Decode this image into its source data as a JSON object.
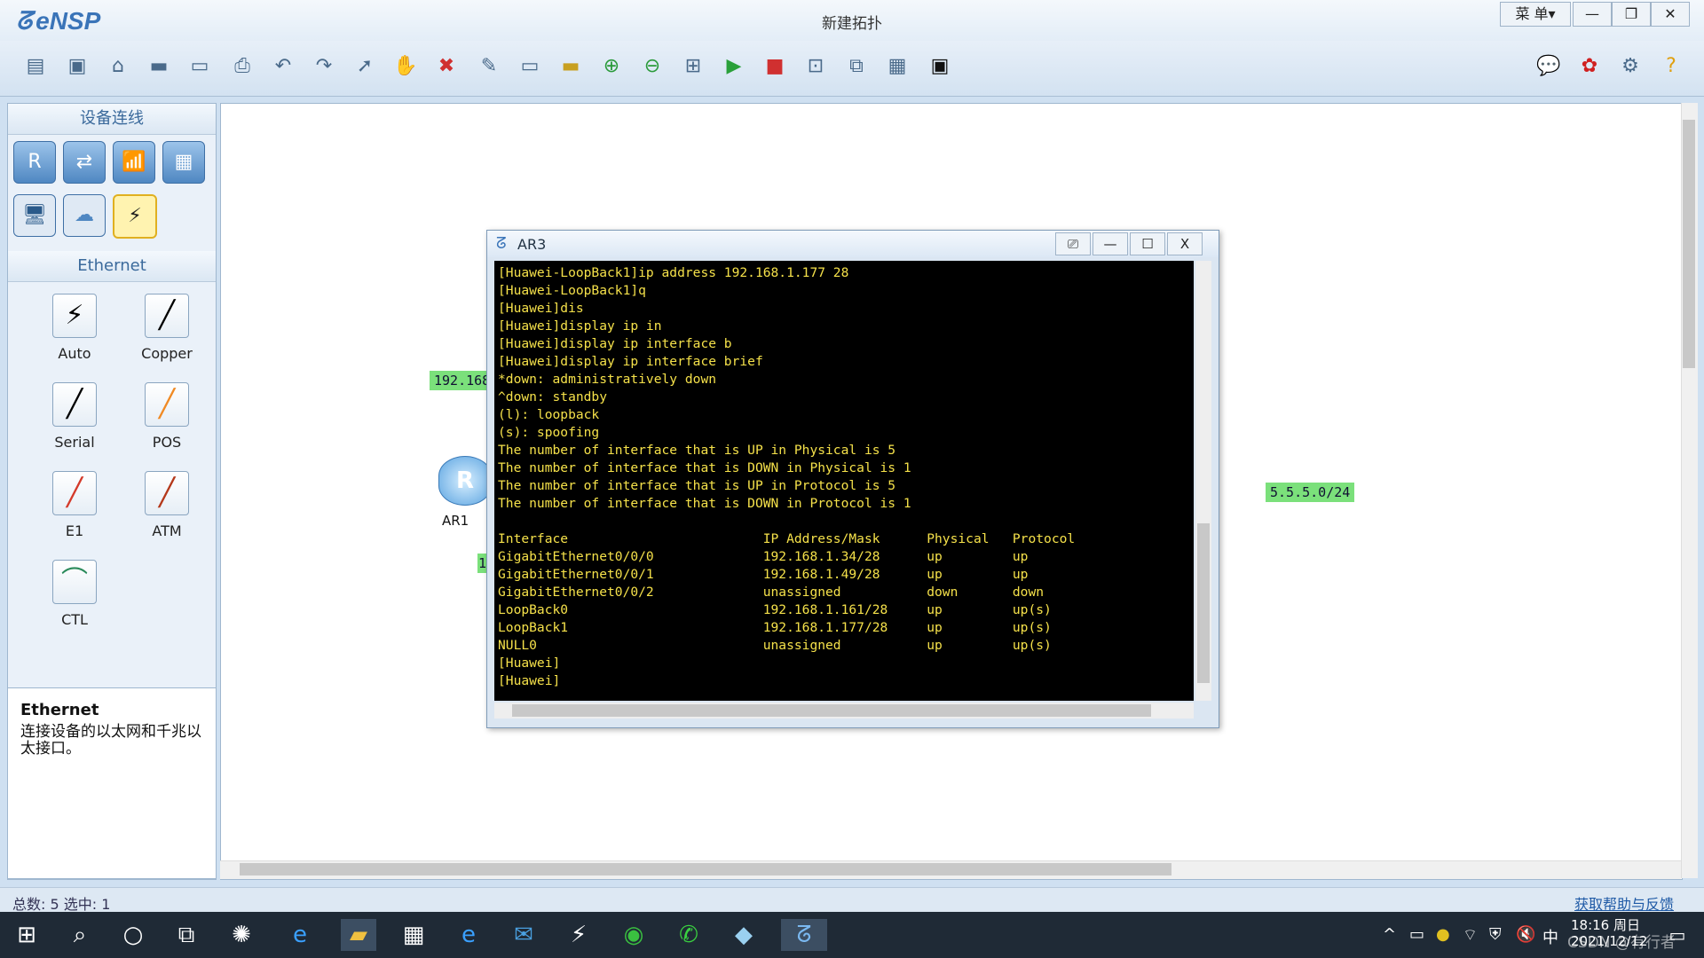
{
  "app": {
    "logo": "eNSP",
    "title": "新建拓扑",
    "menu_label": "菜 单▾",
    "window_buttons": [
      "—",
      "❐",
      "✕"
    ]
  },
  "toolbar": {
    "icons": [
      "new-topology-icon",
      "new-icon",
      "open-icon",
      "save-icon",
      "save-as-icon",
      "print-icon",
      "undo-icon",
      "redo-icon",
      "select-icon",
      "pan-icon",
      "delete-icon",
      "delete-link-icon",
      "text-icon",
      "rectangle-icon",
      "zoom-in-icon",
      "zoom-out-icon",
      "fit-icon",
      "start-icon",
      "stop-icon",
      "capture-icon",
      "topology-icon",
      "grid-icon",
      "console-icon"
    ],
    "right_icons": [
      "chat-icon",
      "huawei-icon",
      "settings-icon",
      "help-icon"
    ]
  },
  "leftpanel": {
    "header": "设备连线",
    "devices": [
      {
        "name": "router",
        "glyph": "R"
      },
      {
        "name": "switch",
        "glyph": "⇄"
      },
      {
        "name": "wlan",
        "glyph": "📶"
      },
      {
        "name": "firewall",
        "glyph": "▦"
      },
      {
        "name": "pc",
        "glyph": "🖥"
      },
      {
        "name": "cloud",
        "glyph": "☁"
      },
      {
        "name": "cable",
        "glyph": "⚡"
      }
    ],
    "section": "Ethernet",
    "cables": [
      {
        "label": "Auto",
        "glyph": "⚡",
        "color": "#111"
      },
      {
        "label": "Copper",
        "glyph": "╱",
        "color": "#111"
      },
      {
        "label": "Serial",
        "glyph": "╱",
        "color": "#111"
      },
      {
        "label": "POS",
        "glyph": "╱",
        "color": "#f08a24"
      },
      {
        "label": "E1",
        "glyph": "╱",
        "color": "#d43a2a"
      },
      {
        "label": "ATM",
        "glyph": "╱",
        "color": "#b4381a"
      },
      {
        "label": "CTL",
        "glyph": "⌒",
        "color": "#2a8a5a"
      }
    ],
    "desc_title": "Ethernet",
    "desc_text": "连接设备的以太网和千兆以太接口。"
  },
  "canvas": {
    "labels": [
      "192.168",
      "5.5.5.0/24",
      "1"
    ],
    "router_label": "AR1",
    "router_glyph": "R"
  },
  "terminal": {
    "title": "AR3",
    "buttons": [
      "⎚",
      "—",
      "☐",
      "X"
    ],
    "lines": [
      "[Huawei-LoopBack1]ip address 192.168.1.177 28",
      "[Huawei-LoopBack1]q",
      "[Huawei]dis",
      "[Huawei]display ip in",
      "[Huawei]display ip interface b",
      "[Huawei]display ip interface brief",
      "*down: administratively down",
      "^down: standby",
      "(l): loopback",
      "(s): spoofing",
      "The number of interface that is UP in Physical is 5",
      "The number of interface that is DOWN in Physical is 1",
      "The number of interface that is UP in Protocol is 5",
      "The number of interface that is DOWN in Protocol is 1",
      "",
      "Interface                         IP Address/Mask      Physical   Protocol",
      "GigabitEthernet0/0/0              192.168.1.34/28      up         up",
      "GigabitEthernet0/0/1              192.168.1.49/28      up         up",
      "GigabitEthernet0/0/2              unassigned           down       down",
      "LoopBack0                         192.168.1.161/28     up         up(s)",
      "LoopBack1                         192.168.1.177/28     up         up(s)",
      "NULL0                             unassigned           up         up(s)",
      "[Huawei]",
      "[Huawei]"
    ]
  },
  "statusbar": {
    "left": "总数: 5  选中: 1",
    "right": "获取帮助与反馈"
  },
  "taskbar": {
    "apps": [
      "windows-start-icon",
      "search-icon",
      "cortana-icon",
      "task-view-icon",
      "app-icon",
      "ie-icon",
      "file-explorer-icon",
      "store-icon",
      "edge-icon",
      "mail-icon",
      "app-bolt-icon",
      "browser-icon",
      "wechat-icon",
      "app-box-icon",
      "ensp-icon"
    ],
    "tray": [
      "^",
      "▭",
      "●",
      "⌔",
      "⛨",
      "🔇",
      "中"
    ],
    "time": "18:16 周日",
    "date": "2021/12/12",
    "watermark": "CSDN @有行者"
  }
}
